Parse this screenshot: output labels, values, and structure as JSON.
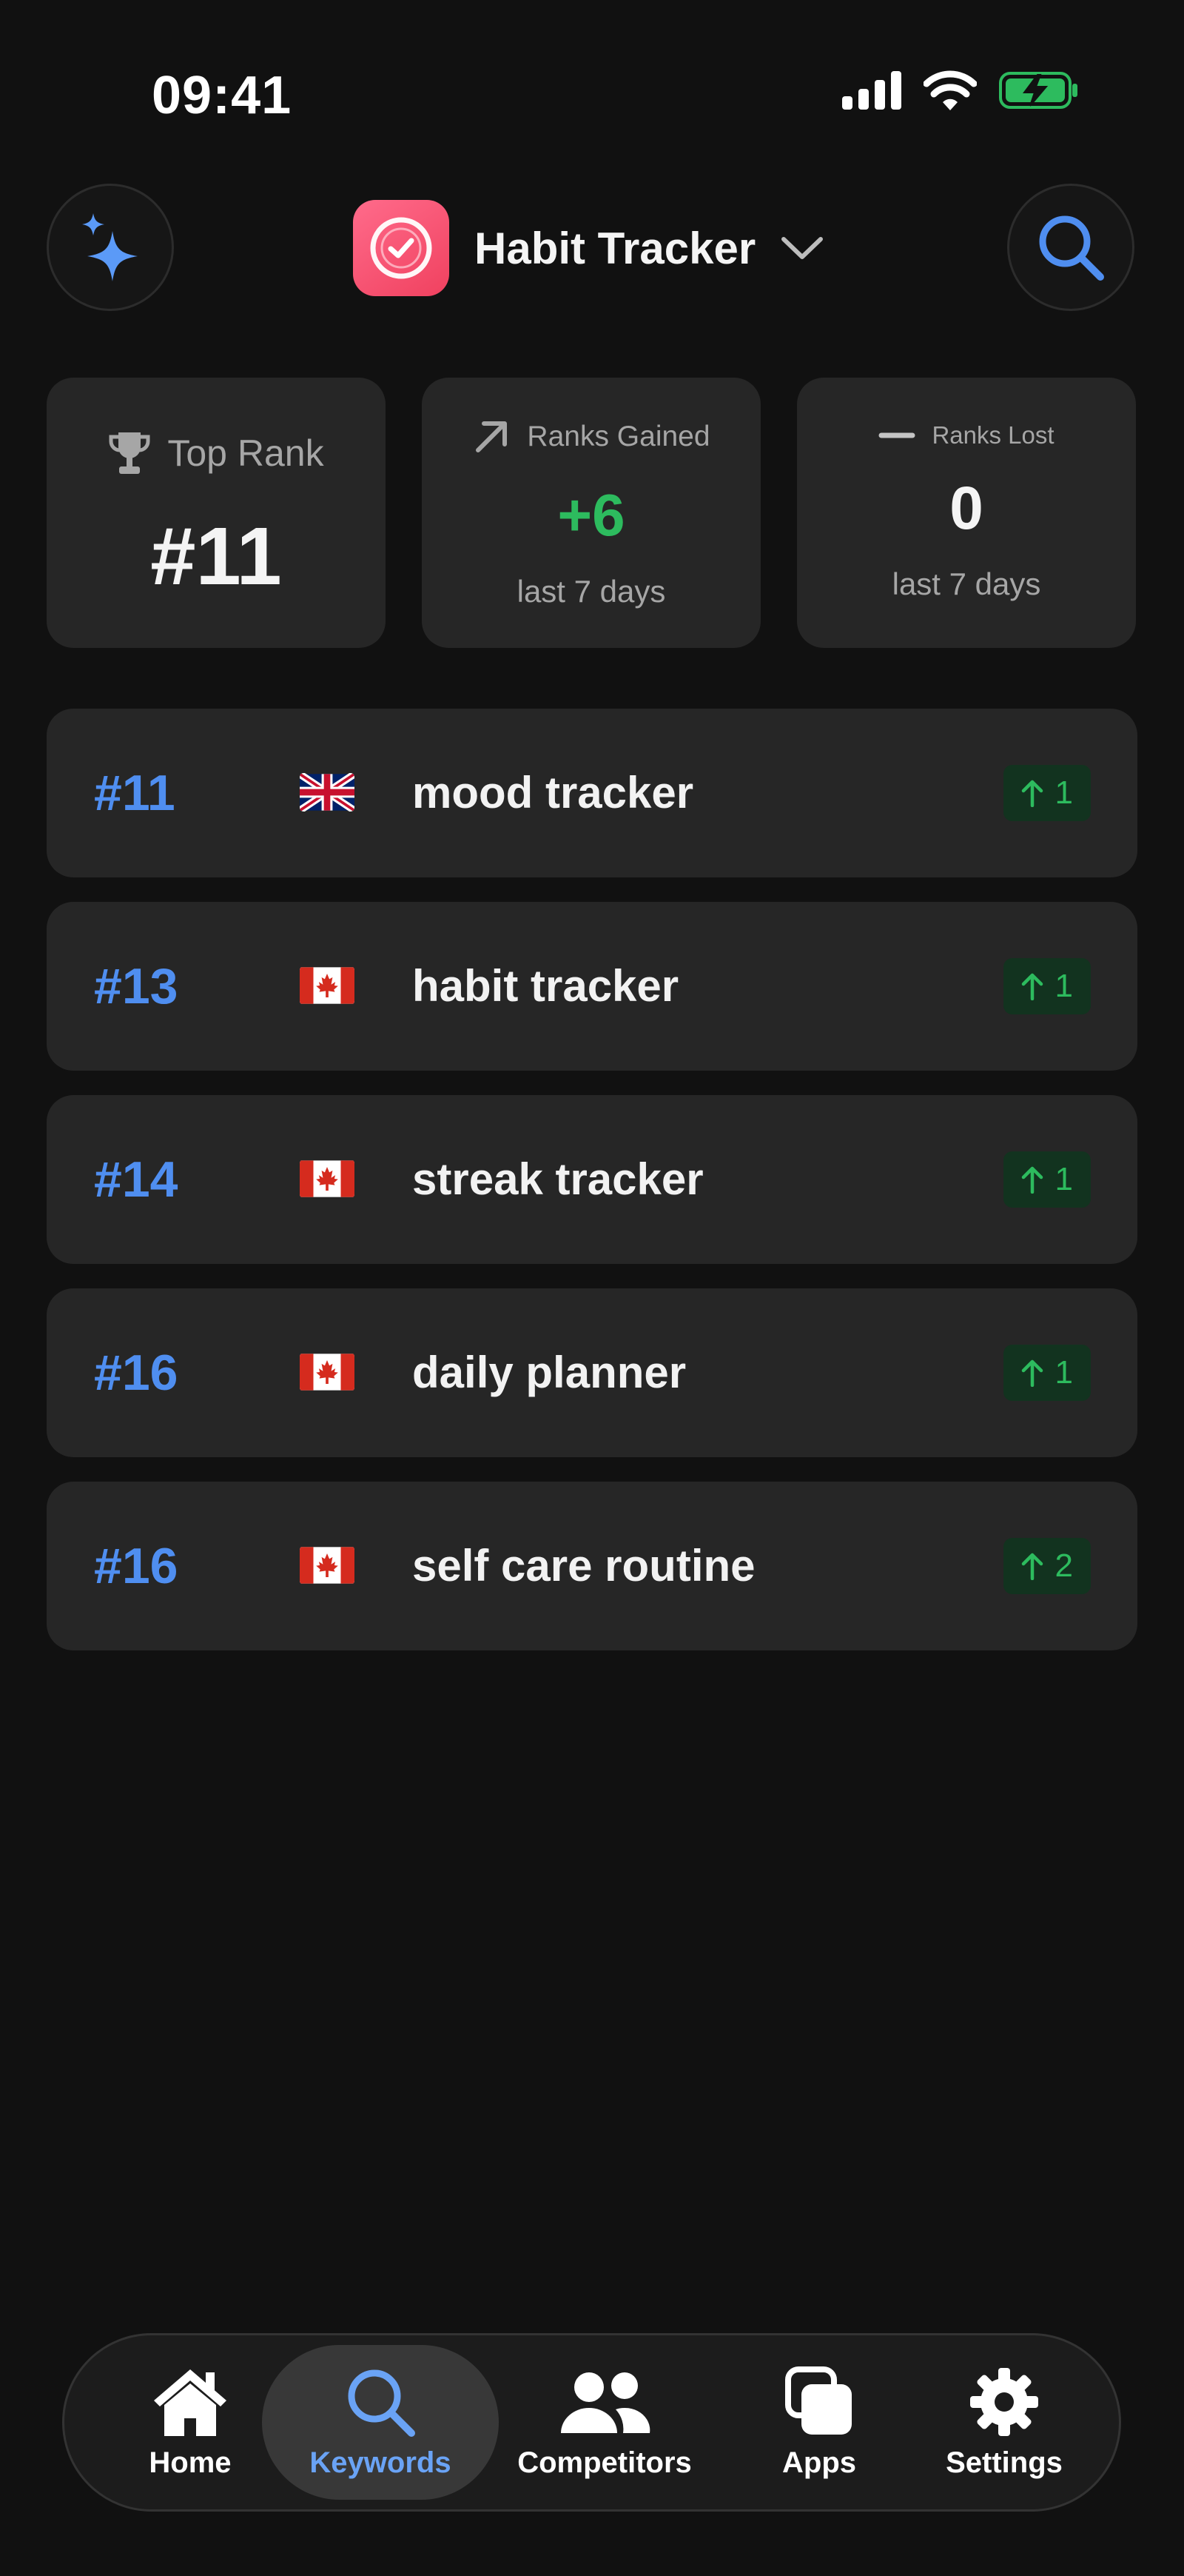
{
  "status_bar": {
    "time": "09:41"
  },
  "header": {
    "app_name": "Habit Tracker"
  },
  "stats": {
    "top_rank": {
      "label": "Top Rank",
      "value": "#11"
    },
    "ranks_gained": {
      "label": "Ranks Gained",
      "value": "+6",
      "period": "last 7 days"
    },
    "ranks_lost": {
      "label": "Ranks Lost",
      "value": "0",
      "period": "last 7 days"
    }
  },
  "keywords": [
    {
      "rank": "#11",
      "country": "uk-flag",
      "keyword": "mood tracker",
      "change": "1"
    },
    {
      "rank": "#13",
      "country": "canada-flag",
      "keyword": "habit tracker",
      "change": "1"
    },
    {
      "rank": "#14",
      "country": "canada-flag",
      "keyword": "streak tracker",
      "change": "1"
    },
    {
      "rank": "#16",
      "country": "canada-flag",
      "keyword": "daily planner",
      "change": "1"
    },
    {
      "rank": "#16",
      "country": "canada-flag",
      "keyword": "self care routine",
      "change": "2"
    }
  ],
  "tabs": [
    {
      "label": "Home",
      "icon": "home-icon"
    },
    {
      "label": "Keywords",
      "icon": "search-icon",
      "active": true
    },
    {
      "label": "Competitors",
      "icon": "people-icon"
    },
    {
      "label": "Apps",
      "icon": "apps-icon"
    },
    {
      "label": "Settings",
      "icon": "gear-icon"
    }
  ],
  "colors": {
    "background": "#111111",
    "card": "#262626",
    "accent_blue": "#4f8ef0",
    "positive_green": "#2dbb5e",
    "badge_bg": "#12331f",
    "active_tab_text": "#6aa3f5"
  }
}
